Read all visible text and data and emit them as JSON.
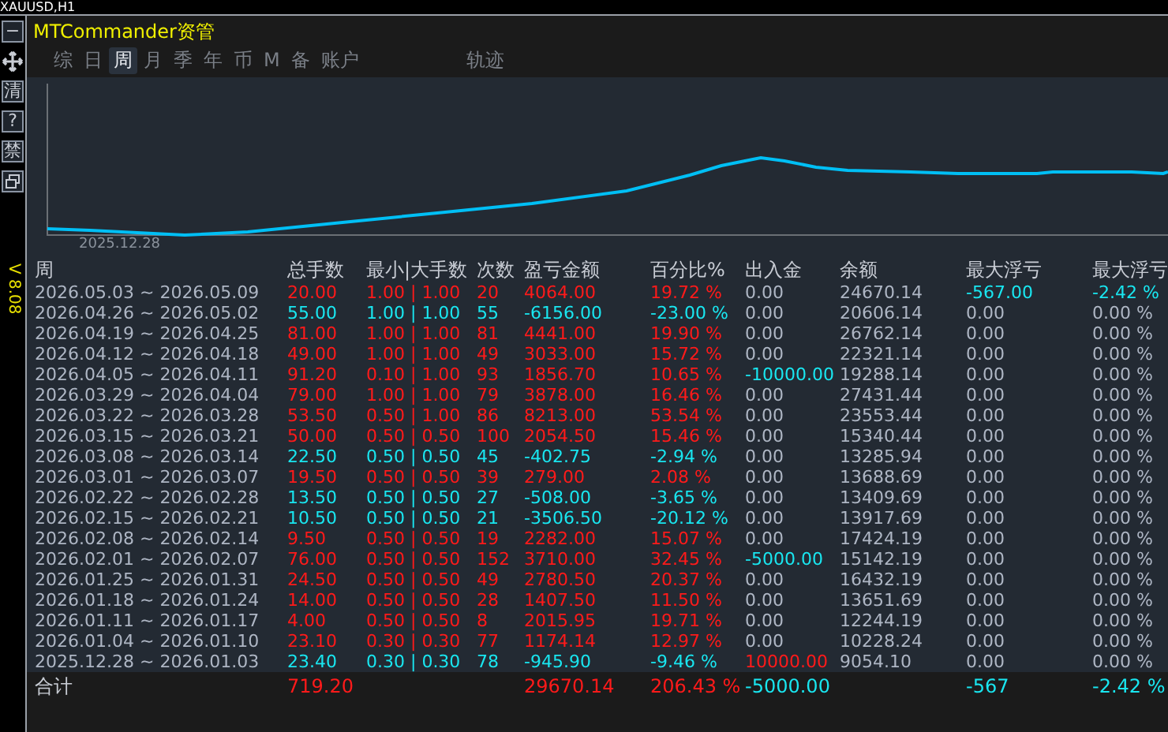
{
  "symbol_label": "XAUUSD,H1",
  "toolbar": {
    "buttons": [
      {
        "kind": "text",
        "label": "−"
      },
      {
        "kind": "move"
      },
      {
        "kind": "text",
        "label": "清"
      },
      {
        "kind": "text",
        "label": "?"
      },
      {
        "kind": "text",
        "label": "禁"
      },
      {
        "kind": "restore"
      }
    ],
    "version": "V 8.08"
  },
  "window": {
    "title": "MTCommander资管"
  },
  "tabs": [
    {
      "label": "综",
      "selected": false
    },
    {
      "label": "日",
      "selected": false
    },
    {
      "label": "周",
      "selected": true
    },
    {
      "label": "月",
      "selected": false
    },
    {
      "label": "季",
      "selected": false
    },
    {
      "label": "年",
      "selected": false
    },
    {
      "label": "币",
      "selected": false
    },
    {
      "label": "M",
      "selected": false
    },
    {
      "label": "备",
      "selected": false
    },
    {
      "label": "账户",
      "selected": false
    }
  ],
  "extra_tabs": [
    {
      "label": "轨迹",
      "selected": false
    }
  ],
  "chart": {
    "start_label": "2025.12.28"
  },
  "table": {
    "columns": [
      "周",
      "总手数",
      "最小|大手数",
      "次数",
      "盈亏金额",
      "百分比%",
      "出入金",
      "余额",
      "最大浮亏",
      "最大浮亏"
    ],
    "rows": [
      {
        "cells": [
          {
            "text": "2026.05.03 ~ 2026.05.09",
            "color": "#aeb6c4"
          },
          {
            "text": "20.00",
            "color": "#ff1a1a"
          },
          {
            "text": "1.00 | 1.00",
            "color": "#ff1a1a"
          },
          {
            "text": "20",
            "color": "#ff1a1a"
          },
          {
            "text": "4064.00",
            "color": "#ff1a1a"
          },
          {
            "text": "19.72 %",
            "color": "#ff1a1a"
          },
          {
            "text": "0.00",
            "color": "#aeb6c4"
          },
          {
            "text": "24670.14",
            "color": "#aeb6c4"
          },
          {
            "text": "-567.00",
            "color": "#19e6f0"
          },
          {
            "text": "-2.42 %",
            "color": "#19e6f0"
          }
        ]
      },
      {
        "cells": [
          {
            "text": "2026.04.26 ~ 2026.05.02",
            "color": "#aeb6c4"
          },
          {
            "text": "55.00",
            "color": "#19e6f0"
          },
          {
            "text": "1.00 | 1.00",
            "color": "#19e6f0"
          },
          {
            "text": "55",
            "color": "#19e6f0"
          },
          {
            "text": "-6156.00",
            "color": "#19e6f0"
          },
          {
            "text": "-23.00 %",
            "color": "#19e6f0"
          },
          {
            "text": "0.00",
            "color": "#aeb6c4"
          },
          {
            "text": "20606.14",
            "color": "#aeb6c4"
          },
          {
            "text": "0.00",
            "color": "#aeb6c4"
          },
          {
            "text": "0.00 %",
            "color": "#aeb6c4"
          }
        ]
      },
      {
        "cells": [
          {
            "text": "2026.04.19 ~ 2026.04.25",
            "color": "#aeb6c4"
          },
          {
            "text": "81.00",
            "color": "#ff1a1a"
          },
          {
            "text": "1.00 | 1.00",
            "color": "#ff1a1a"
          },
          {
            "text": "81",
            "color": "#ff1a1a"
          },
          {
            "text": "4441.00",
            "color": "#ff1a1a"
          },
          {
            "text": "19.90 %",
            "color": "#ff1a1a"
          },
          {
            "text": "0.00",
            "color": "#aeb6c4"
          },
          {
            "text": "26762.14",
            "color": "#aeb6c4"
          },
          {
            "text": "0.00",
            "color": "#aeb6c4"
          },
          {
            "text": "0.00 %",
            "color": "#aeb6c4"
          }
        ]
      },
      {
        "cells": [
          {
            "text": "2026.04.12 ~ 2026.04.18",
            "color": "#aeb6c4"
          },
          {
            "text": "49.00",
            "color": "#ff1a1a"
          },
          {
            "text": "1.00 | 1.00",
            "color": "#ff1a1a"
          },
          {
            "text": "49",
            "color": "#ff1a1a"
          },
          {
            "text": "3033.00",
            "color": "#ff1a1a"
          },
          {
            "text": "15.72 %",
            "color": "#ff1a1a"
          },
          {
            "text": "0.00",
            "color": "#aeb6c4"
          },
          {
            "text": "22321.14",
            "color": "#aeb6c4"
          },
          {
            "text": "0.00",
            "color": "#aeb6c4"
          },
          {
            "text": "0.00 %",
            "color": "#aeb6c4"
          }
        ]
      },
      {
        "cells": [
          {
            "text": "2026.04.05 ~ 2026.04.11",
            "color": "#aeb6c4"
          },
          {
            "text": "91.20",
            "color": "#ff1a1a"
          },
          {
            "text": "0.10 | 1.00",
            "color": "#ff1a1a"
          },
          {
            "text": "93",
            "color": "#ff1a1a"
          },
          {
            "text": "1856.70",
            "color": "#ff1a1a"
          },
          {
            "text": "10.65 %",
            "color": "#ff1a1a"
          },
          {
            "text": "-10000.00",
            "color": "#19e6f0"
          },
          {
            "text": "19288.14",
            "color": "#aeb6c4"
          },
          {
            "text": "0.00",
            "color": "#aeb6c4"
          },
          {
            "text": "0.00 %",
            "color": "#aeb6c4"
          }
        ]
      },
      {
        "cells": [
          {
            "text": "2026.03.29 ~ 2026.04.04",
            "color": "#aeb6c4"
          },
          {
            "text": "79.00",
            "color": "#ff1a1a"
          },
          {
            "text": "1.00 | 1.00",
            "color": "#ff1a1a"
          },
          {
            "text": "79",
            "color": "#ff1a1a"
          },
          {
            "text": "3878.00",
            "color": "#ff1a1a"
          },
          {
            "text": "16.46 %",
            "color": "#ff1a1a"
          },
          {
            "text": "0.00",
            "color": "#aeb6c4"
          },
          {
            "text": "27431.44",
            "color": "#aeb6c4"
          },
          {
            "text": "0.00",
            "color": "#aeb6c4"
          },
          {
            "text": "0.00 %",
            "color": "#aeb6c4"
          }
        ]
      },
      {
        "cells": [
          {
            "text": "2026.03.22 ~ 2026.03.28",
            "color": "#aeb6c4"
          },
          {
            "text": "53.50",
            "color": "#ff1a1a"
          },
          {
            "text": "0.50 | 1.00",
            "color": "#ff1a1a"
          },
          {
            "text": "86",
            "color": "#ff1a1a"
          },
          {
            "text": "8213.00",
            "color": "#ff1a1a"
          },
          {
            "text": "53.54 %",
            "color": "#ff1a1a"
          },
          {
            "text": "0.00",
            "color": "#aeb6c4"
          },
          {
            "text": "23553.44",
            "color": "#aeb6c4"
          },
          {
            "text": "0.00",
            "color": "#aeb6c4"
          },
          {
            "text": "0.00 %",
            "color": "#aeb6c4"
          }
        ]
      },
      {
        "cells": [
          {
            "text": "2026.03.15 ~ 2026.03.21",
            "color": "#aeb6c4"
          },
          {
            "text": "50.00",
            "color": "#ff1a1a"
          },
          {
            "text": "0.50 | 0.50",
            "color": "#ff1a1a"
          },
          {
            "text": "100",
            "color": "#ff1a1a"
          },
          {
            "text": "2054.50",
            "color": "#ff1a1a"
          },
          {
            "text": "15.46 %",
            "color": "#ff1a1a"
          },
          {
            "text": "0.00",
            "color": "#aeb6c4"
          },
          {
            "text": "15340.44",
            "color": "#aeb6c4"
          },
          {
            "text": "0.00",
            "color": "#aeb6c4"
          },
          {
            "text": "0.00 %",
            "color": "#aeb6c4"
          }
        ]
      },
      {
        "cells": [
          {
            "text": "2026.03.08 ~ 2026.03.14",
            "color": "#aeb6c4"
          },
          {
            "text": "22.50",
            "color": "#19e6f0"
          },
          {
            "text": "0.50 | 0.50",
            "color": "#19e6f0"
          },
          {
            "text": "45",
            "color": "#19e6f0"
          },
          {
            "text": "-402.75",
            "color": "#19e6f0"
          },
          {
            "text": "-2.94 %",
            "color": "#19e6f0"
          },
          {
            "text": "0.00",
            "color": "#aeb6c4"
          },
          {
            "text": "13285.94",
            "color": "#aeb6c4"
          },
          {
            "text": "0.00",
            "color": "#aeb6c4"
          },
          {
            "text": "0.00 %",
            "color": "#aeb6c4"
          }
        ]
      },
      {
        "cells": [
          {
            "text": "2026.03.01 ~ 2026.03.07",
            "color": "#aeb6c4"
          },
          {
            "text": "19.50",
            "color": "#ff1a1a"
          },
          {
            "text": "0.50 | 0.50",
            "color": "#ff1a1a"
          },
          {
            "text": "39",
            "color": "#ff1a1a"
          },
          {
            "text": "279.00",
            "color": "#ff1a1a"
          },
          {
            "text": "2.08 %",
            "color": "#ff1a1a"
          },
          {
            "text": "0.00",
            "color": "#aeb6c4"
          },
          {
            "text": "13688.69",
            "color": "#aeb6c4"
          },
          {
            "text": "0.00",
            "color": "#aeb6c4"
          },
          {
            "text": "0.00 %",
            "color": "#aeb6c4"
          }
        ]
      },
      {
        "cells": [
          {
            "text": "2026.02.22 ~ 2026.02.28",
            "color": "#aeb6c4"
          },
          {
            "text": "13.50",
            "color": "#19e6f0"
          },
          {
            "text": "0.50 | 0.50",
            "color": "#19e6f0"
          },
          {
            "text": "27",
            "color": "#19e6f0"
          },
          {
            "text": "-508.00",
            "color": "#19e6f0"
          },
          {
            "text": "-3.65 %",
            "color": "#19e6f0"
          },
          {
            "text": "0.00",
            "color": "#aeb6c4"
          },
          {
            "text": "13409.69",
            "color": "#aeb6c4"
          },
          {
            "text": "0.00",
            "color": "#aeb6c4"
          },
          {
            "text": "0.00 %",
            "color": "#aeb6c4"
          }
        ]
      },
      {
        "cells": [
          {
            "text": "2026.02.15 ~ 2026.02.21",
            "color": "#aeb6c4"
          },
          {
            "text": "10.50",
            "color": "#19e6f0"
          },
          {
            "text": "0.50 | 0.50",
            "color": "#19e6f0"
          },
          {
            "text": "21",
            "color": "#19e6f0"
          },
          {
            "text": "-3506.50",
            "color": "#19e6f0"
          },
          {
            "text": "-20.12 %",
            "color": "#19e6f0"
          },
          {
            "text": "0.00",
            "color": "#aeb6c4"
          },
          {
            "text": "13917.69",
            "color": "#aeb6c4"
          },
          {
            "text": "0.00",
            "color": "#aeb6c4"
          },
          {
            "text": "0.00 %",
            "color": "#aeb6c4"
          }
        ]
      },
      {
        "cells": [
          {
            "text": "2026.02.08 ~ 2026.02.14",
            "color": "#aeb6c4"
          },
          {
            "text": "9.50",
            "color": "#ff1a1a"
          },
          {
            "text": "0.50 | 0.50",
            "color": "#ff1a1a"
          },
          {
            "text": "19",
            "color": "#ff1a1a"
          },
          {
            "text": "2282.00",
            "color": "#ff1a1a"
          },
          {
            "text": "15.07 %",
            "color": "#ff1a1a"
          },
          {
            "text": "0.00",
            "color": "#aeb6c4"
          },
          {
            "text": "17424.19",
            "color": "#aeb6c4"
          },
          {
            "text": "0.00",
            "color": "#aeb6c4"
          },
          {
            "text": "0.00 %",
            "color": "#aeb6c4"
          }
        ]
      },
      {
        "cells": [
          {
            "text": "2026.02.01 ~ 2026.02.07",
            "color": "#aeb6c4"
          },
          {
            "text": "76.00",
            "color": "#ff1a1a"
          },
          {
            "text": "0.50 | 0.50",
            "color": "#ff1a1a"
          },
          {
            "text": "152",
            "color": "#ff1a1a"
          },
          {
            "text": "3710.00",
            "color": "#ff1a1a"
          },
          {
            "text": "32.45 %",
            "color": "#ff1a1a"
          },
          {
            "text": "-5000.00",
            "color": "#19e6f0"
          },
          {
            "text": "15142.19",
            "color": "#aeb6c4"
          },
          {
            "text": "0.00",
            "color": "#aeb6c4"
          },
          {
            "text": "0.00 %",
            "color": "#aeb6c4"
          }
        ]
      },
      {
        "cells": [
          {
            "text": "2026.01.25 ~ 2026.01.31",
            "color": "#aeb6c4"
          },
          {
            "text": "24.50",
            "color": "#ff1a1a"
          },
          {
            "text": "0.50 | 0.50",
            "color": "#ff1a1a"
          },
          {
            "text": "49",
            "color": "#ff1a1a"
          },
          {
            "text": "2780.50",
            "color": "#ff1a1a"
          },
          {
            "text": "20.37 %",
            "color": "#ff1a1a"
          },
          {
            "text": "0.00",
            "color": "#aeb6c4"
          },
          {
            "text": "16432.19",
            "color": "#aeb6c4"
          },
          {
            "text": "0.00",
            "color": "#aeb6c4"
          },
          {
            "text": "0.00 %",
            "color": "#aeb6c4"
          }
        ]
      },
      {
        "cells": [
          {
            "text": "2026.01.18 ~ 2026.01.24",
            "color": "#aeb6c4"
          },
          {
            "text": "14.00",
            "color": "#ff1a1a"
          },
          {
            "text": "0.50 | 0.50",
            "color": "#ff1a1a"
          },
          {
            "text": "28",
            "color": "#ff1a1a"
          },
          {
            "text": "1407.50",
            "color": "#ff1a1a"
          },
          {
            "text": "11.50 %",
            "color": "#ff1a1a"
          },
          {
            "text": "0.00",
            "color": "#aeb6c4"
          },
          {
            "text": "13651.69",
            "color": "#aeb6c4"
          },
          {
            "text": "0.00",
            "color": "#aeb6c4"
          },
          {
            "text": "0.00 %",
            "color": "#aeb6c4"
          }
        ]
      },
      {
        "cells": [
          {
            "text": "2026.01.11 ~ 2026.01.17",
            "color": "#aeb6c4"
          },
          {
            "text": "4.00",
            "color": "#ff1a1a"
          },
          {
            "text": "0.50 | 0.50",
            "color": "#ff1a1a"
          },
          {
            "text": "8",
            "color": "#ff1a1a"
          },
          {
            "text": "2015.95",
            "color": "#ff1a1a"
          },
          {
            "text": "19.71 %",
            "color": "#ff1a1a"
          },
          {
            "text": "0.00",
            "color": "#aeb6c4"
          },
          {
            "text": "12244.19",
            "color": "#aeb6c4"
          },
          {
            "text": "0.00",
            "color": "#aeb6c4"
          },
          {
            "text": "0.00 %",
            "color": "#aeb6c4"
          }
        ]
      },
      {
        "cells": [
          {
            "text": "2026.01.04 ~ 2026.01.10",
            "color": "#aeb6c4"
          },
          {
            "text": "23.10",
            "color": "#ff1a1a"
          },
          {
            "text": "0.30 | 0.30",
            "color": "#ff1a1a"
          },
          {
            "text": "77",
            "color": "#ff1a1a"
          },
          {
            "text": "1174.14",
            "color": "#ff1a1a"
          },
          {
            "text": "12.97 %",
            "color": "#ff1a1a"
          },
          {
            "text": "0.00",
            "color": "#aeb6c4"
          },
          {
            "text": "10228.24",
            "color": "#aeb6c4"
          },
          {
            "text": "0.00",
            "color": "#aeb6c4"
          },
          {
            "text": "0.00 %",
            "color": "#aeb6c4"
          }
        ]
      },
      {
        "cells": [
          {
            "text": "2025.12.28 ~ 2026.01.03",
            "color": "#aeb6c4"
          },
          {
            "text": "23.40",
            "color": "#19e6f0"
          },
          {
            "text": "0.30 | 0.30",
            "color": "#19e6f0"
          },
          {
            "text": "78",
            "color": "#19e6f0"
          },
          {
            "text": "-945.90",
            "color": "#19e6f0"
          },
          {
            "text": "-9.46 %",
            "color": "#19e6f0"
          },
          {
            "text": "10000.00",
            "color": "#ff1a1a"
          },
          {
            "text": "9054.10",
            "color": "#aeb6c4"
          },
          {
            "text": "0.00",
            "color": "#aeb6c4"
          },
          {
            "text": "0.00 %",
            "color": "#aeb6c4"
          }
        ]
      }
    ],
    "total": {
      "label": {
        "text": "合计",
        "color": "#c8ccd4"
      },
      "lots": {
        "text": "719.20",
        "color": "#ff1a1a"
      },
      "pnl": {
        "text": "29670.14",
        "color": "#ff1a1a"
      },
      "pct": {
        "text": "206.43 %",
        "color": "#ff1a1a"
      },
      "flow": {
        "text": "-5000.00",
        "color": "#19e6f0"
      },
      "max_float": {
        "text": "-567",
        "color": "#19e6f0"
      },
      "max_float_pct": {
        "text": "-2.42 %",
        "color": "#19e6f0"
      }
    }
  }
}
